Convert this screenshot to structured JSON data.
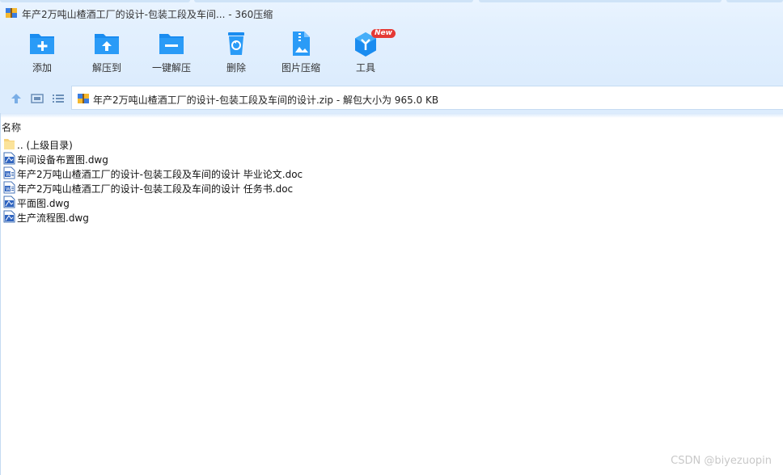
{
  "window": {
    "title": "年产2万吨山楂酒工厂的设计-包装工段及车间... - 360压缩"
  },
  "toolbar": {
    "items": [
      {
        "label": "添加",
        "icon": "add-folder-icon"
      },
      {
        "label": "解压到",
        "icon": "extract-to-icon"
      },
      {
        "label": "一键解压",
        "icon": "one-click-extract-icon"
      },
      {
        "label": "删除",
        "icon": "trash-icon"
      },
      {
        "label": "图片压缩",
        "icon": "image-compress-icon"
      },
      {
        "label": "工具",
        "icon": "tools-icon",
        "badge": "New"
      }
    ]
  },
  "nav": {
    "path": "年产2万吨山楂酒工厂的设计-包装工段及车间的设计.zip - 解包大小为 965.0 KB"
  },
  "list": {
    "column_name": "名称",
    "files": [
      {
        "name": ".. (上级目录)",
        "type": "folder"
      },
      {
        "name": "车间设备布置图.dwg",
        "type": "dwg"
      },
      {
        "name": "年产2万吨山楂酒工厂的设计-包装工段及车间的设计 毕业论文.doc",
        "type": "doc"
      },
      {
        "name": "年产2万吨山楂酒工厂的设计-包装工段及车间的设计 任务书.doc",
        "type": "doc"
      },
      {
        "name": "平面图.dwg",
        "type": "dwg"
      },
      {
        "name": "生产流程图.dwg",
        "type": "dwg"
      }
    ]
  },
  "watermark": "CSDN @biyezuopin",
  "colors": {
    "accent": "#1a8cf0",
    "toolbar_bg": "#e3f0fe",
    "badge": "#e53935"
  }
}
